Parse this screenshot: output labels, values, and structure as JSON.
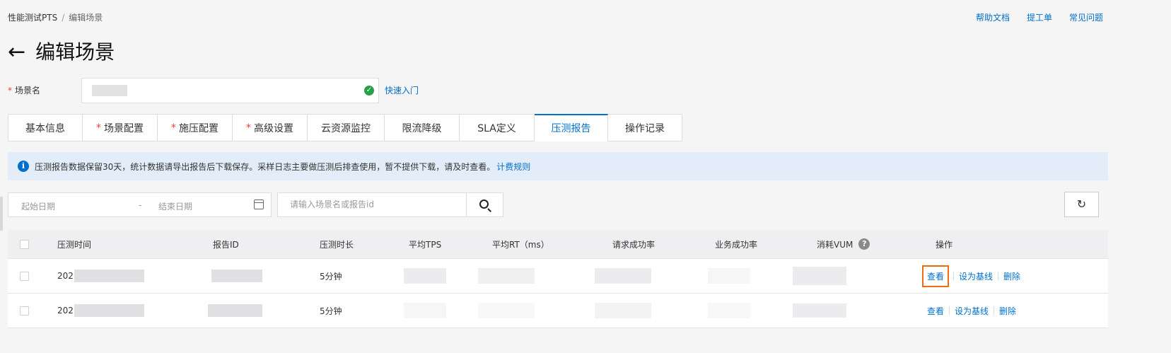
{
  "breadcrumb": {
    "root": "性能测试PTS",
    "separator": "/",
    "current": "编辑场景"
  },
  "top_links": [
    "帮助文档",
    "提工单",
    "常见问题"
  ],
  "page": {
    "back": "←",
    "title": "编辑场景"
  },
  "scene": {
    "required_mark": "*",
    "label": "场景名",
    "quick_start": "快速入门",
    "valid_icon": "check-circle-icon"
  },
  "tabs": [
    {
      "label": "基本信息",
      "required": ""
    },
    {
      "label": "场景配置",
      "required": "*"
    },
    {
      "label": "施压配置",
      "required": "*"
    },
    {
      "label": "高级设置",
      "required": "*"
    },
    {
      "label": "云资源监控",
      "required": ""
    },
    {
      "label": "限流降级",
      "required": ""
    },
    {
      "label": "SLA定义",
      "required": ""
    },
    {
      "label": "压测报告",
      "required": "",
      "active": true
    },
    {
      "label": "操作记录",
      "required": ""
    }
  ],
  "notice": {
    "icon": "i",
    "text": "压测报告数据保留30天，统计数据请导出报告后下载保存。采样日志主要做压测后排查使用，暂不提供下载，请及时查看。",
    "link": "计费规则"
  },
  "filters": {
    "start_placeholder": "起始日期",
    "dash": "-",
    "end_placeholder": "结束日期",
    "search_placeholder": "请输入场景名或报告id"
  },
  "table": {
    "headers": {
      "time": "压测时间",
      "report_id": "报告ID",
      "duration": "压测时长",
      "avg_tps": "平均TPS",
      "avg_rt": "平均RT（ms）",
      "req_success": "请求成功率",
      "biz_success": "业务成功率",
      "vum": "消耗VUM",
      "vum_help": "?",
      "actions": "操作"
    },
    "rows": [
      {
        "time": "202",
        "duration": "5分钟",
        "view": "查看",
        "baseline": "设为基线",
        "delete": "删除"
      },
      {
        "time": "202",
        "duration": "5分钟",
        "view": "查看",
        "baseline": "设为基线",
        "delete": "删除"
      }
    ]
  },
  "colors": {
    "accent": "#0070cc",
    "highlight": "#ef6c13",
    "required": "#e5413b",
    "success": "#26a146"
  }
}
